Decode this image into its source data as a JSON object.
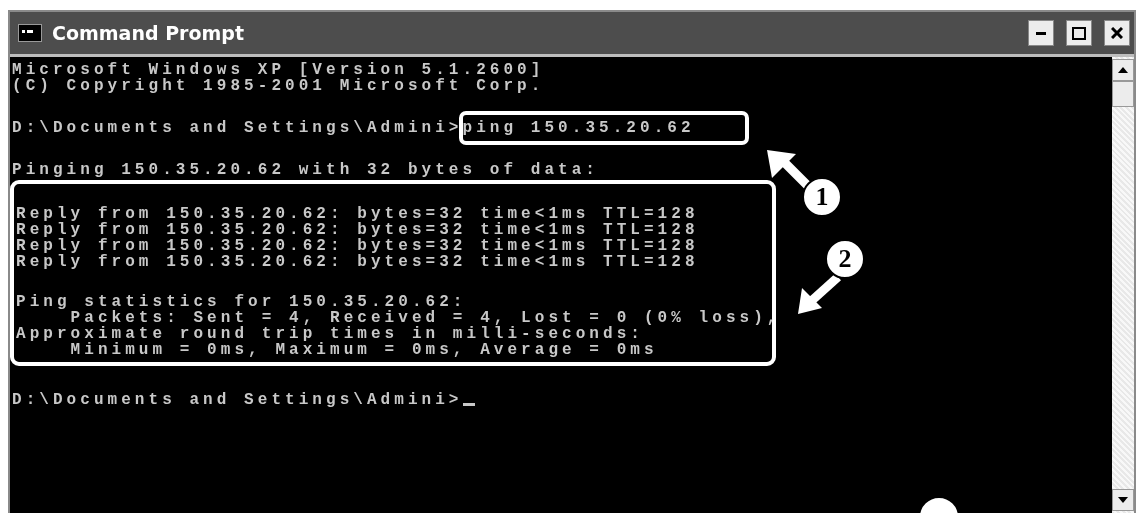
{
  "window": {
    "title": "Command Prompt"
  },
  "console": {
    "intro": [
      "Microsoft Windows XP [Version 5.1.2600]",
      "(C) Copyright 1985-2001 Microsoft Corp."
    ],
    "command_prompt": {
      "prompt": "D:\\Documents and Settings\\Admini>",
      "command": "ping 150.35.20.62"
    },
    "pinging": "Pinging 150.35.20.62 with 32 bytes of data:",
    "replies": [
      "Reply from 150.35.20.62: bytes=32 time<1ms TTL=128",
      "Reply from 150.35.20.62: bytes=32 time<1ms TTL=128",
      "Reply from 150.35.20.62: bytes=32 time<1ms TTL=128",
      "Reply from 150.35.20.62: bytes=32 time<1ms TTL=128"
    ],
    "statistics": [
      "Ping statistics for 150.35.20.62:",
      "    Packets: Sent = 4, Received = 4, Lost = 0 (0% loss),",
      "Approximate round trip times in milli-seconds:",
      "    Minimum = 0ms, Maximum = 0ms, Average = 0ms"
    ],
    "final_prompt": "D:\\Documents and Settings\\Admini>"
  },
  "callouts": [
    {
      "label": "1"
    },
    {
      "label": "2"
    }
  ]
}
